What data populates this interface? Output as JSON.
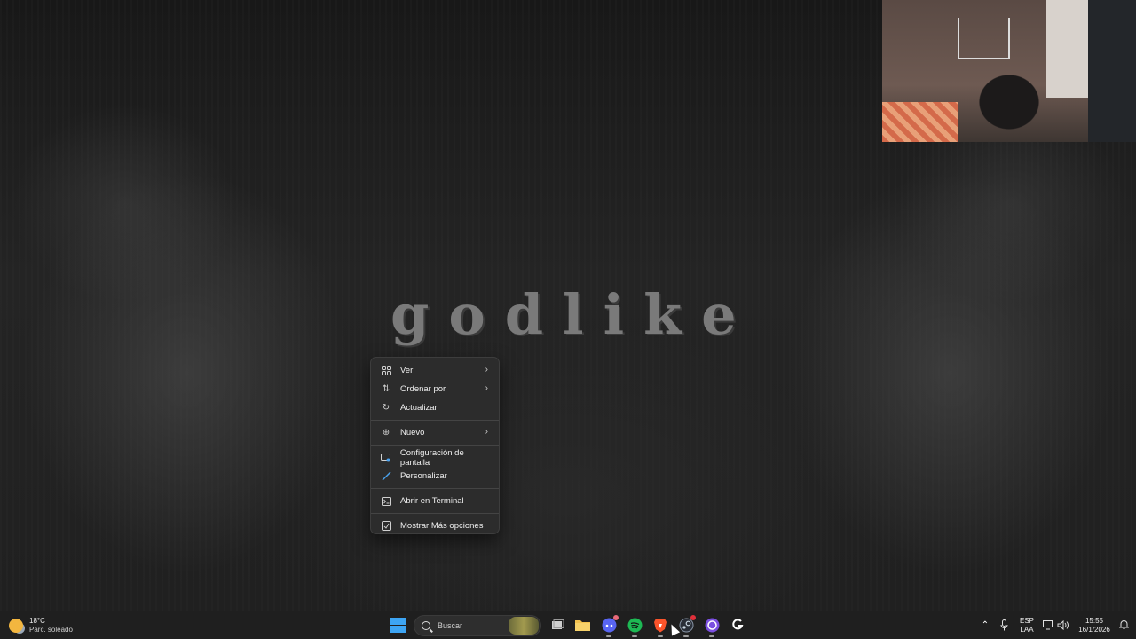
{
  "wallpaper": {
    "title": "godlike"
  },
  "context_menu": {
    "items": [
      {
        "label": "Ver",
        "icon": "grid-icon",
        "submenu": true
      },
      {
        "label": "Ordenar por",
        "icon": "sort-icon",
        "submenu": true
      },
      {
        "label": "Actualizar",
        "icon": "refresh-icon",
        "submenu": false
      },
      {
        "label": "Nuevo",
        "icon": "plus-circle-icon",
        "submenu": true
      },
      {
        "label": "Configuración de pantalla",
        "icon": "display-settings-icon",
        "submenu": false
      },
      {
        "label": "Personalizar",
        "icon": "pen-icon",
        "submenu": false
      },
      {
        "label": "Abrir en Terminal",
        "icon": "terminal-icon",
        "submenu": false
      },
      {
        "label": "Mostrar Más opciones",
        "icon": "more-options-icon",
        "submenu": false
      }
    ]
  },
  "taskbar": {
    "weather": {
      "temperature": "18°C",
      "condition": "Parc. soleado",
      "icon": "partly-sunny-icon"
    },
    "search_placeholder": "Buscar",
    "apps": [
      {
        "name": "task-view",
        "icon": "task-view-icon"
      },
      {
        "name": "file-explorer",
        "icon": "folder-icon",
        "color": "#f2c14e"
      },
      {
        "name": "discord",
        "icon": "discord-icon",
        "color": "#5865f2"
      },
      {
        "name": "spotify",
        "icon": "spotify-icon",
        "color": "#1db954"
      },
      {
        "name": "brave",
        "icon": "brave-icon",
        "color": "#fb542b"
      },
      {
        "name": "steam",
        "icon": "steam-icon",
        "color": "#1b2838"
      },
      {
        "name": "app-purple",
        "icon": "circle-app-icon",
        "color": "#7b4fe0"
      },
      {
        "name": "logitech-g-hub",
        "icon": "g-hub-icon",
        "color": "#ffffff"
      }
    ],
    "tray": {
      "language": "ESP",
      "layout": "LAA",
      "time": "15:55",
      "date": "16/1/2026"
    }
  }
}
